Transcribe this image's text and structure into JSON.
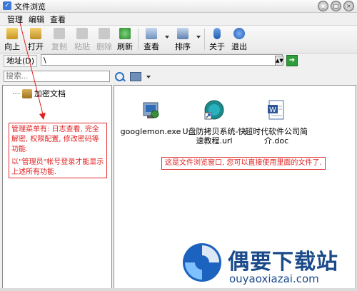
{
  "window": {
    "title": "文件浏览",
    "minimize": "_",
    "restore": "□",
    "close": "×"
  },
  "menu": {
    "items": [
      "管理",
      "编辑",
      "查看"
    ]
  },
  "toolbar": {
    "up": "向上",
    "open": "打开",
    "copy": "复制",
    "paste": "粘贴",
    "delete": "删除",
    "refresh": "刷新",
    "view": "查看",
    "sort": "排序",
    "about": "关于",
    "exit": "退出"
  },
  "address": {
    "label": "地址(D)",
    "value": "\\"
  },
  "search": {
    "placeholder": "搜索..."
  },
  "tree": {
    "root": "加密文档"
  },
  "files": [
    {
      "name": "googlemon.exe",
      "icon": "exe-icon"
    },
    {
      "name": "U盘防拷贝系统-快速教程.url",
      "icon": "url-shortcut-icon"
    },
    {
      "name": "超时代软件公司简介.doc",
      "icon": "word-doc-icon"
    }
  ],
  "notes": {
    "menu_note_line1": "管理菜单有: 日志查看, 完全解密, 权限配置, 修改密码等功能.",
    "menu_note_line2": "以\"管理员\"帐号登录才能显示上述所有功能.",
    "window_note": "这是文件浏览窗口, 您可以直接使用里面的文件了."
  },
  "watermark": {
    "brand": "偶要下载站",
    "url": "ouyaoxiazai.com"
  },
  "colors": {
    "annotation": "#e02020",
    "brand": "#1a4a8a"
  }
}
